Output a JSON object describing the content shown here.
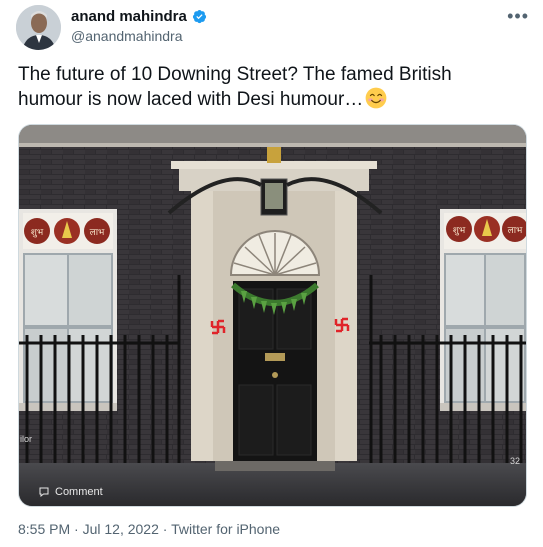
{
  "author": {
    "name": "anand mahindra",
    "handle": "@anandmahindra",
    "verified": true
  },
  "tweet": {
    "text": "The future of 10 Downing Street?  The famed British humour is now laced with Desi humour…",
    "emoji": "smiling-face-icon"
  },
  "media": {
    "comment_label": "Comment",
    "image_number": "32",
    "side_text": "ilor",
    "signs": [
      "शुभ",
      "लाभ"
    ]
  },
  "meta": {
    "time": "8:55 PM",
    "separator": " · ",
    "date": "Jul 12, 2022",
    "source": "Twitter for iPhone"
  },
  "colors": {
    "verified_blue": "#1d9bf0",
    "brick": "#2b2a2d",
    "door": "#151515",
    "swastika": "#e0242a"
  }
}
